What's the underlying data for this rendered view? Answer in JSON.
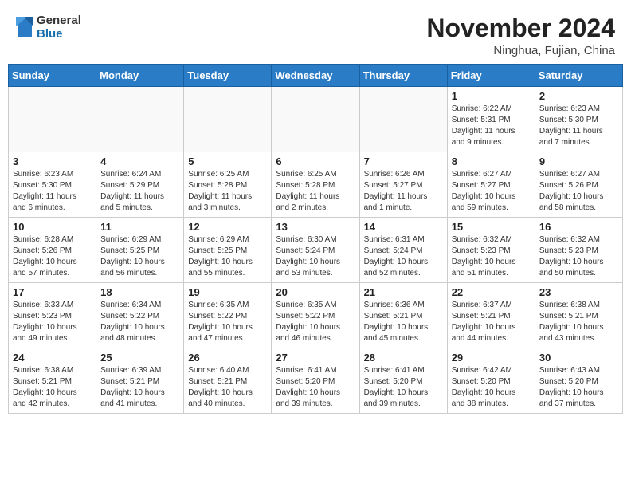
{
  "header": {
    "logo_general": "General",
    "logo_blue": "Blue",
    "month_title": "November 2024",
    "location": "Ninghua, Fujian, China"
  },
  "weekdays": [
    "Sunday",
    "Monday",
    "Tuesday",
    "Wednesday",
    "Thursday",
    "Friday",
    "Saturday"
  ],
  "weeks": [
    [
      {
        "day": "",
        "info": "",
        "empty": true
      },
      {
        "day": "",
        "info": "",
        "empty": true
      },
      {
        "day": "",
        "info": "",
        "empty": true
      },
      {
        "day": "",
        "info": "",
        "empty": true
      },
      {
        "day": "",
        "info": "",
        "empty": true
      },
      {
        "day": "1",
        "info": "Sunrise: 6:22 AM\nSunset: 5:31 PM\nDaylight: 11 hours\nand 9 minutes.",
        "empty": false
      },
      {
        "day": "2",
        "info": "Sunrise: 6:23 AM\nSunset: 5:30 PM\nDaylight: 11 hours\nand 7 minutes.",
        "empty": false
      }
    ],
    [
      {
        "day": "3",
        "info": "Sunrise: 6:23 AM\nSunset: 5:30 PM\nDaylight: 11 hours\nand 6 minutes.",
        "empty": false
      },
      {
        "day": "4",
        "info": "Sunrise: 6:24 AM\nSunset: 5:29 PM\nDaylight: 11 hours\nand 5 minutes.",
        "empty": false
      },
      {
        "day": "5",
        "info": "Sunrise: 6:25 AM\nSunset: 5:28 PM\nDaylight: 11 hours\nand 3 minutes.",
        "empty": false
      },
      {
        "day": "6",
        "info": "Sunrise: 6:25 AM\nSunset: 5:28 PM\nDaylight: 11 hours\nand 2 minutes.",
        "empty": false
      },
      {
        "day": "7",
        "info": "Sunrise: 6:26 AM\nSunset: 5:27 PM\nDaylight: 11 hours\nand 1 minute.",
        "empty": false
      },
      {
        "day": "8",
        "info": "Sunrise: 6:27 AM\nSunset: 5:27 PM\nDaylight: 10 hours\nand 59 minutes.",
        "empty": false
      },
      {
        "day": "9",
        "info": "Sunrise: 6:27 AM\nSunset: 5:26 PM\nDaylight: 10 hours\nand 58 minutes.",
        "empty": false
      }
    ],
    [
      {
        "day": "10",
        "info": "Sunrise: 6:28 AM\nSunset: 5:26 PM\nDaylight: 10 hours\nand 57 minutes.",
        "empty": false
      },
      {
        "day": "11",
        "info": "Sunrise: 6:29 AM\nSunset: 5:25 PM\nDaylight: 10 hours\nand 56 minutes.",
        "empty": false
      },
      {
        "day": "12",
        "info": "Sunrise: 6:29 AM\nSunset: 5:25 PM\nDaylight: 10 hours\nand 55 minutes.",
        "empty": false
      },
      {
        "day": "13",
        "info": "Sunrise: 6:30 AM\nSunset: 5:24 PM\nDaylight: 10 hours\nand 53 minutes.",
        "empty": false
      },
      {
        "day": "14",
        "info": "Sunrise: 6:31 AM\nSunset: 5:24 PM\nDaylight: 10 hours\nand 52 minutes.",
        "empty": false
      },
      {
        "day": "15",
        "info": "Sunrise: 6:32 AM\nSunset: 5:23 PM\nDaylight: 10 hours\nand 51 minutes.",
        "empty": false
      },
      {
        "day": "16",
        "info": "Sunrise: 6:32 AM\nSunset: 5:23 PM\nDaylight: 10 hours\nand 50 minutes.",
        "empty": false
      }
    ],
    [
      {
        "day": "17",
        "info": "Sunrise: 6:33 AM\nSunset: 5:23 PM\nDaylight: 10 hours\nand 49 minutes.",
        "empty": false
      },
      {
        "day": "18",
        "info": "Sunrise: 6:34 AM\nSunset: 5:22 PM\nDaylight: 10 hours\nand 48 minutes.",
        "empty": false
      },
      {
        "day": "19",
        "info": "Sunrise: 6:35 AM\nSunset: 5:22 PM\nDaylight: 10 hours\nand 47 minutes.",
        "empty": false
      },
      {
        "day": "20",
        "info": "Sunrise: 6:35 AM\nSunset: 5:22 PM\nDaylight: 10 hours\nand 46 minutes.",
        "empty": false
      },
      {
        "day": "21",
        "info": "Sunrise: 6:36 AM\nSunset: 5:21 PM\nDaylight: 10 hours\nand 45 minutes.",
        "empty": false
      },
      {
        "day": "22",
        "info": "Sunrise: 6:37 AM\nSunset: 5:21 PM\nDaylight: 10 hours\nand 44 minutes.",
        "empty": false
      },
      {
        "day": "23",
        "info": "Sunrise: 6:38 AM\nSunset: 5:21 PM\nDaylight: 10 hours\nand 43 minutes.",
        "empty": false
      }
    ],
    [
      {
        "day": "24",
        "info": "Sunrise: 6:38 AM\nSunset: 5:21 PM\nDaylight: 10 hours\nand 42 minutes.",
        "empty": false
      },
      {
        "day": "25",
        "info": "Sunrise: 6:39 AM\nSunset: 5:21 PM\nDaylight: 10 hours\nand 41 minutes.",
        "empty": false
      },
      {
        "day": "26",
        "info": "Sunrise: 6:40 AM\nSunset: 5:21 PM\nDaylight: 10 hours\nand 40 minutes.",
        "empty": false
      },
      {
        "day": "27",
        "info": "Sunrise: 6:41 AM\nSunset: 5:20 PM\nDaylight: 10 hours\nand 39 minutes.",
        "empty": false
      },
      {
        "day": "28",
        "info": "Sunrise: 6:41 AM\nSunset: 5:20 PM\nDaylight: 10 hours\nand 39 minutes.",
        "empty": false
      },
      {
        "day": "29",
        "info": "Sunrise: 6:42 AM\nSunset: 5:20 PM\nDaylight: 10 hours\nand 38 minutes.",
        "empty": false
      },
      {
        "day": "30",
        "info": "Sunrise: 6:43 AM\nSunset: 5:20 PM\nDaylight: 10 hours\nand 37 minutes.",
        "empty": false
      }
    ]
  ]
}
